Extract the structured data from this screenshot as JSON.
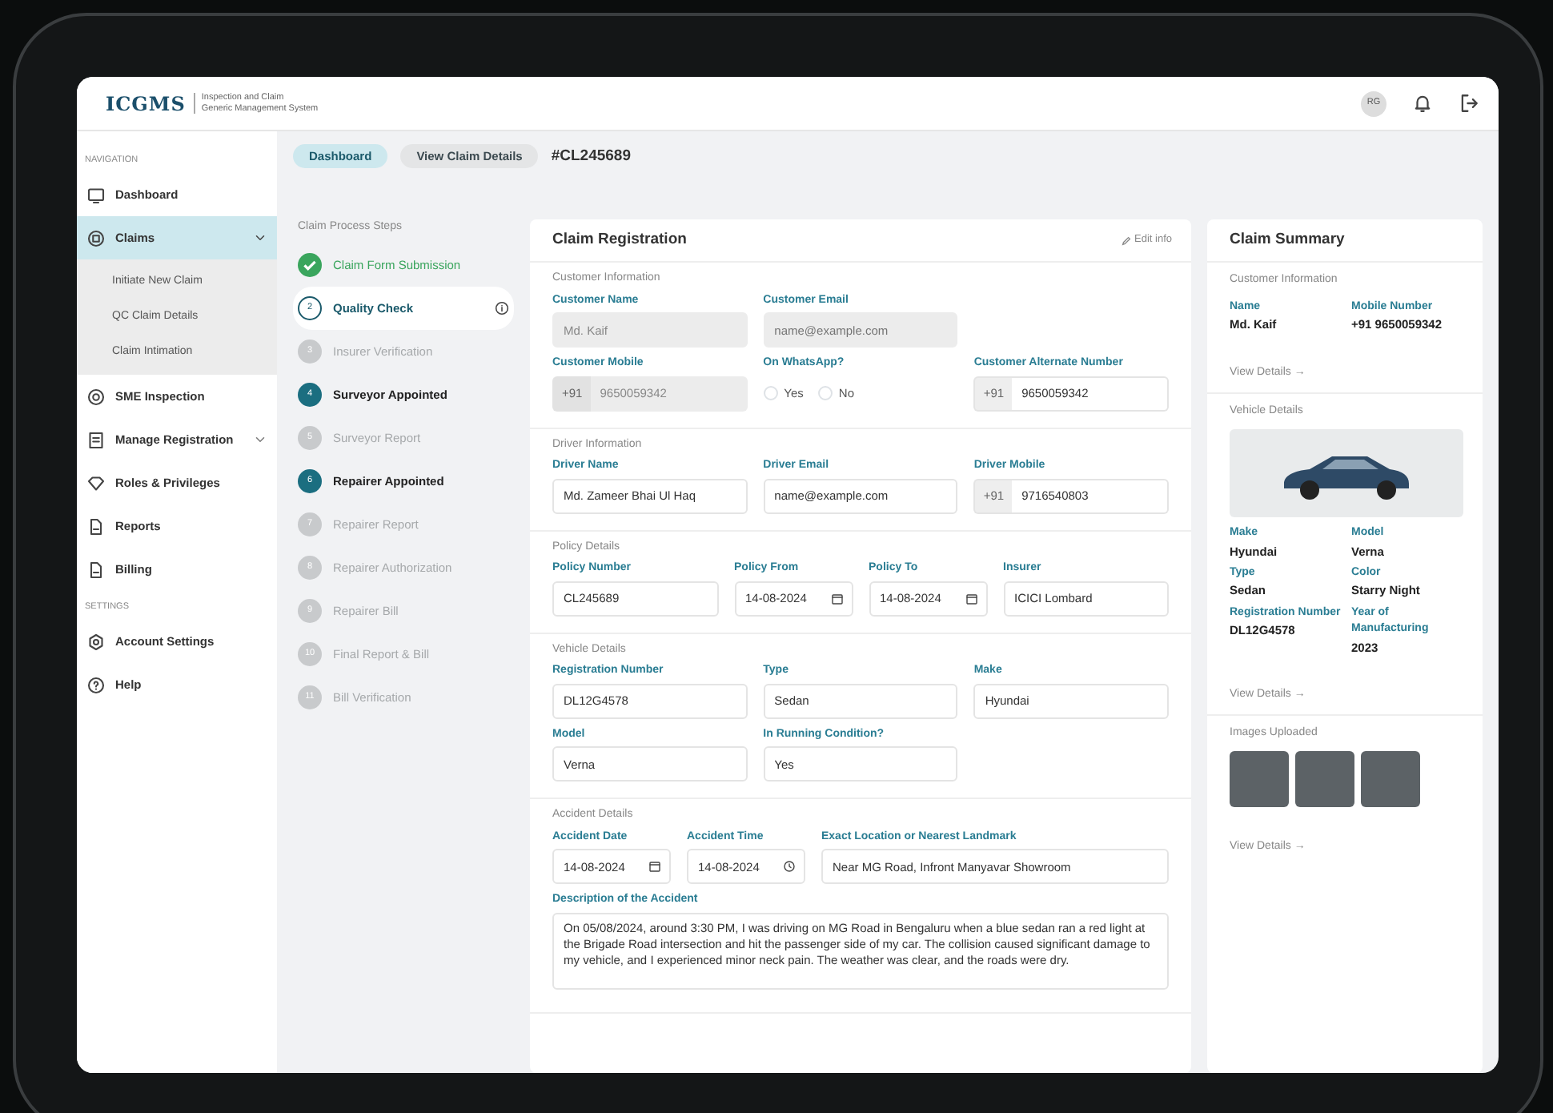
{
  "header": {
    "logo": "ICGMS",
    "subtitle": [
      "Inspection and Claim",
      "Generic Management System"
    ],
    "avatar": "RG"
  },
  "sidebar": {
    "sections": [
      {
        "title": "NAVIGATION",
        "items": [
          {
            "label": "Dashboard",
            "selected": false
          },
          {
            "label": "Claims",
            "selected": true,
            "expanded": true,
            "children": [
              {
                "label": "Initiate New Claim",
                "selected": false
              },
              {
                "label": "QC Claim Details",
                "selected": false
              },
              {
                "label": "Claim Intimation",
                "selected": false
              }
            ]
          },
          {
            "label": "SME Inspection",
            "selected": false
          },
          {
            "label": "Manage Registration",
            "selected": false,
            "expanded": false
          },
          {
            "label": "Roles & Privileges",
            "selected": false
          },
          {
            "label": "Reports",
            "selected": false
          },
          {
            "label": "Billing",
            "selected": false
          }
        ]
      },
      {
        "title": "SETTINGS",
        "items": [
          {
            "label": "Account Settings",
            "selected": false
          },
          {
            "label": "Help",
            "selected": false
          }
        ]
      }
    ]
  },
  "breadcrumbs": [
    {
      "label": "Dashboard",
      "selected": true
    },
    {
      "label": "View Claim Details",
      "selected": false
    }
  ],
  "claim_id": "#CL245689",
  "steps": {
    "title": "Claim Process Steps",
    "items": [
      {
        "label": "Claim Form Submission",
        "kind": "done"
      },
      {
        "number": "2",
        "label": "Quality Check",
        "kind": "current"
      },
      {
        "number": "3",
        "label": "Insurer Verification",
        "kind": "pending"
      },
      {
        "number": "4",
        "label": "Surveyor Appointed",
        "kind": "active"
      },
      {
        "number": "5",
        "label": "Surveyor Report",
        "kind": "pending"
      },
      {
        "number": "6",
        "label": "Repairer Appointed",
        "kind": "active"
      },
      {
        "number": "7",
        "label": "Repairer Report",
        "kind": "pending"
      },
      {
        "number": "8",
        "label": "Repairer Authorization",
        "kind": "pending"
      },
      {
        "number": "9",
        "label": "Repairer Bill",
        "kind": "pending"
      },
      {
        "number": "10",
        "label": "Final Report & Bill",
        "kind": "pending"
      },
      {
        "number": "11",
        "label": "Bill Verification",
        "kind": "pending"
      }
    ]
  },
  "form": {
    "title": "Claim Registration",
    "edit_label": "Edit info",
    "sections": [
      {
        "title": "Customer Information",
        "rows": [
          [
            {
              "label": "Customer Name",
              "kind": "text",
              "value": "Md. Kaif",
              "disabled": true
            },
            {
              "label": "Customer Email",
              "kind": "text",
              "placeholder": "name@example.com",
              "disabled": true
            }
          ],
          [
            {
              "label": "Customer Mobile",
              "kind": "phone",
              "prefix": "+91",
              "value": "9650059342",
              "disabled": true
            },
            {
              "label": "On WhatsApp?",
              "kind": "radio",
              "options": [
                {
                  "label": "Yes",
                  "checked": false
                },
                {
                  "label": "No",
                  "checked": false
                }
              ]
            },
            {
              "label": "Customer Alternate Number",
              "kind": "phone",
              "prefix": "+91",
              "value": "9650059342",
              "disabled": false
            }
          ]
        ]
      },
      {
        "title": "Driver Information",
        "rows": [
          [
            {
              "label": "Driver Name",
              "kind": "text",
              "value": "Md. Zameer Bhai Ul Haq",
              "disabled": false
            },
            {
              "label": "Driver Email",
              "kind": "text",
              "value": "name@example.com",
              "disabled": false
            },
            {
              "label": "Driver Mobile",
              "kind": "phone",
              "prefix": "+91",
              "value": "9716540803",
              "disabled": false
            }
          ]
        ]
      },
      {
        "title": "Policy Details",
        "rows": [
          [
            {
              "label": "Policy Number",
              "kind": "text",
              "value": "CL245689",
              "disabled": false
            },
            {
              "label": "Policy From",
              "kind": "date",
              "value": "14-08-2024"
            },
            {
              "label": "Policy To",
              "kind": "date",
              "value": "14-08-2024"
            },
            {
              "label": "Insurer",
              "kind": "select",
              "value": "ICICI Lombard"
            }
          ]
        ]
      },
      {
        "title": "Vehicle Details",
        "rows": [
          [
            {
              "label": "Registration Number",
              "kind": "text",
              "value": "DL12G4578",
              "disabled": false
            },
            {
              "label": "Type",
              "kind": "select",
              "value": "Sedan"
            },
            {
              "label": "Make",
              "kind": "select",
              "value": "Hyundai"
            }
          ],
          [
            {
              "label": "Model",
              "kind": "select",
              "value": "Verna"
            },
            {
              "label": "In Running Condition?",
              "kind": "select",
              "value": "Yes"
            }
          ]
        ]
      },
      {
        "title": "Accident Details",
        "rows": [
          [
            {
              "label": "Accident Date",
              "kind": "date",
              "value": "14-08-2024"
            },
            {
              "label": "Accident Time",
              "kind": "time",
              "value": "14-08-2024"
            },
            {
              "label": "Exact Location or Nearest Landmark",
              "kind": "text",
              "value": "Near MG Road, Infront Manyavar Showroom",
              "disabled": false
            }
          ],
          [
            {
              "label": "Description of the Accident",
              "kind": "textarea",
              "value": "On 05/08/2024, around 3:30 PM, I was driving on MG Road in Bengaluru when a blue sedan ran a red light at the Brigade Road intersection and hit the passenger side of my car. The collision caused significant damage to my vehicle, and I experienced minor neck pain. The weather was clear, and the roads were dry."
            }
          ]
        ]
      }
    ]
  },
  "summary": {
    "title": "Claim Summary",
    "sections": [
      {
        "title": "Customer Information",
        "kind": "pairs",
        "pairs": [
          {
            "label": "Name",
            "value": "Md. Kaif"
          },
          {
            "label": "Mobile Number",
            "value": "+91 9650059342"
          }
        ],
        "link": "View Details →"
      },
      {
        "title": "Vehicle Details",
        "kind": "vehicle",
        "pairs": [
          {
            "label": "Make",
            "value": "Hyundai"
          },
          {
            "label": "Model",
            "value": "Verna"
          },
          {
            "label": "Type",
            "value": "Sedan"
          },
          {
            "label": "Color",
            "value": "Starry Night"
          },
          {
            "label": "Registration Number",
            "value": "DL12G4578"
          },
          {
            "label": "Year of Manufacturing",
            "value": "2023"
          }
        ],
        "link": "View Details →"
      },
      {
        "title": "Images Uploaded",
        "kind": "images",
        "link": "View Details →"
      }
    ]
  }
}
